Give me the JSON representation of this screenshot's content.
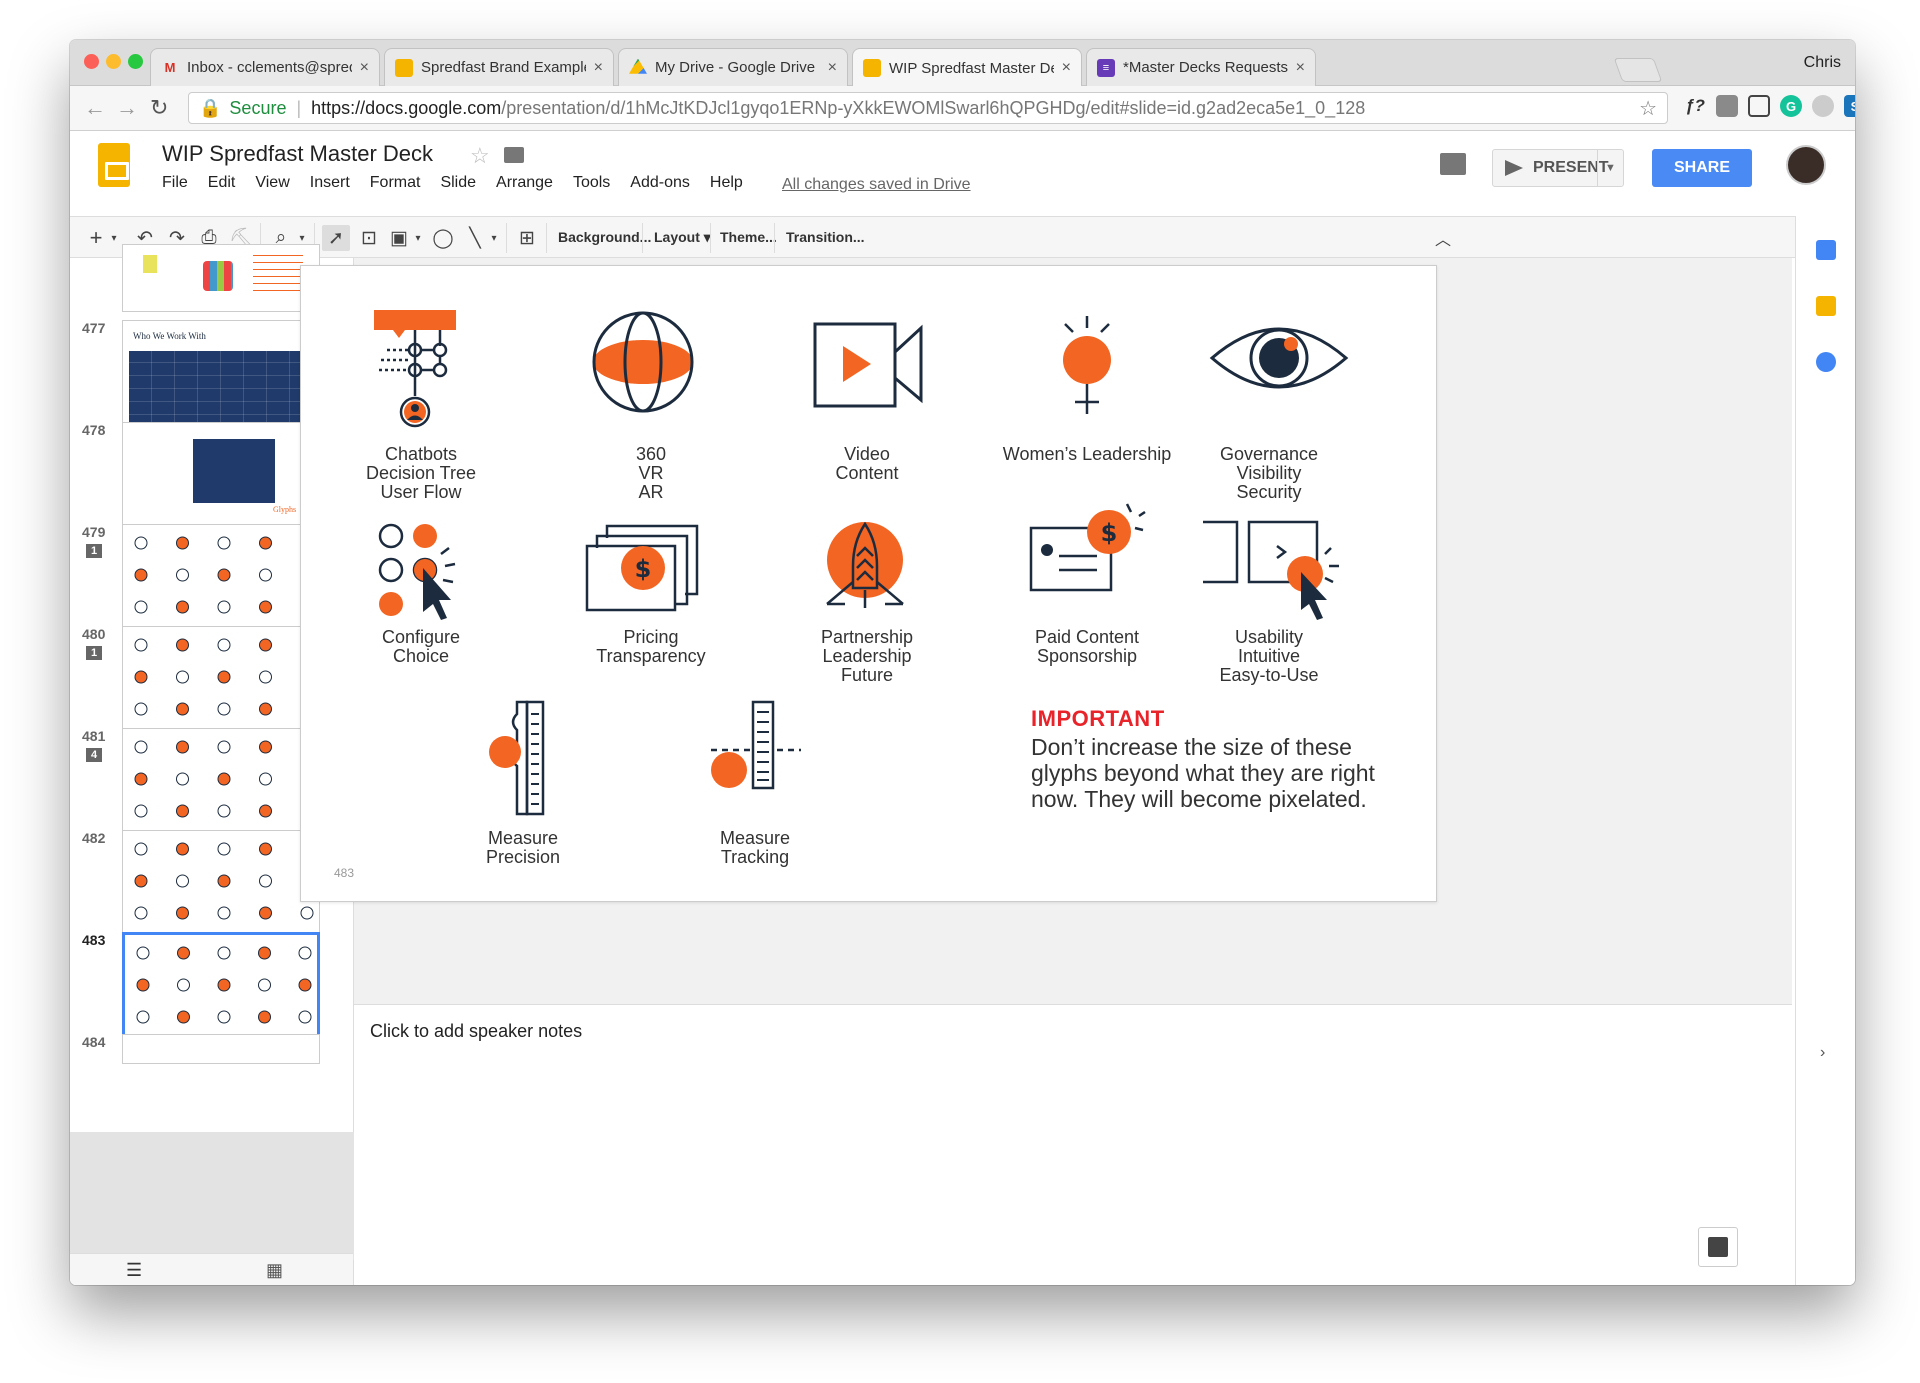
{
  "browser": {
    "profile": "Chris",
    "tabs": [
      {
        "title": "Inbox - cclements@spredfast.c",
        "icon": "gmail-icon"
      },
      {
        "title": "Spredfast Brand Examples - G",
        "icon": "slides-icon"
      },
      {
        "title": "My Drive - Google Drive",
        "icon": "drive-icon"
      },
      {
        "title": "WIP Spredfast Master Deck - G",
        "icon": "slides-icon",
        "active": true
      },
      {
        "title": "*Master Decks Requests & Su",
        "icon": "forms-icon"
      }
    ],
    "address": {
      "secure_label": "Secure",
      "host": "https://docs.google.com",
      "path": "/presentation/d/1hMcJtKDJcl1gyqo1ERNp-yXkkEWOMlSwarl6hQPGHDg/edit#slide=id.g2ad2eca5e1_0_128"
    }
  },
  "app": {
    "doc_title": "WIP Spredfast Master Deck",
    "menu": [
      "File",
      "Edit",
      "View",
      "Insert",
      "Format",
      "Slide",
      "Arrange",
      "Tools",
      "Add-ons",
      "Help"
    ],
    "save_status": "All changes saved in Drive",
    "present_label": "PRESENT",
    "share_label": "SHARE"
  },
  "toolbar": {
    "background_label": "Background...",
    "layout_label": "Layout",
    "theme_label": "Theme...",
    "transition_label": "Transition..."
  },
  "filmstrip": [
    {
      "num": "477",
      "comments": ""
    },
    {
      "num": "478",
      "comments": ""
    },
    {
      "num": "479",
      "comments": "1"
    },
    {
      "num": "480",
      "comments": "1"
    },
    {
      "num": "481",
      "comments": "4"
    },
    {
      "num": "482",
      "comments": ""
    },
    {
      "num": "483",
      "comments": "",
      "selected": true
    },
    {
      "num": "484",
      "comments": ""
    }
  ],
  "thumb_477_title": "Who We Work With",
  "thumb_478_word": "Glyphs",
  "slide": {
    "page_number": "483",
    "glyphs": [
      {
        "lines": [
          "Chatbots",
          "Decision Tree",
          "User Flow"
        ]
      },
      {
        "lines": [
          "360",
          "VR",
          "AR"
        ]
      },
      {
        "lines": [
          "Video",
          "Content"
        ]
      },
      {
        "lines": [
          "Women’s Leadership"
        ]
      },
      {
        "lines": [
          "Governance",
          "Visibility",
          "Security"
        ]
      },
      {
        "lines": [
          "Configure",
          "Choice"
        ]
      },
      {
        "lines": [
          "Pricing",
          "Transparency"
        ]
      },
      {
        "lines": [
          "Partnership",
          "Leadership",
          "Future"
        ]
      },
      {
        "lines": [
          "Paid Content",
          "Sponsorship"
        ]
      },
      {
        "lines": [
          "Usability",
          "Intuitive",
          "Easy-to-Use"
        ]
      },
      {
        "lines": [
          "Measure",
          "Precision"
        ]
      },
      {
        "lines": [
          "Measure",
          "Tracking"
        ]
      }
    ],
    "important_heading": "IMPORTANT",
    "important_body": "Don’t increase the size of these glyphs beyond what they are right now. They will become pixelated."
  },
  "notes_placeholder": "Click to add speaker notes",
  "colors": {
    "orange": "#f26522",
    "navy": "#1c2b3e",
    "accent_blue": "#4a8af4",
    "important_red": "#e8232a"
  }
}
